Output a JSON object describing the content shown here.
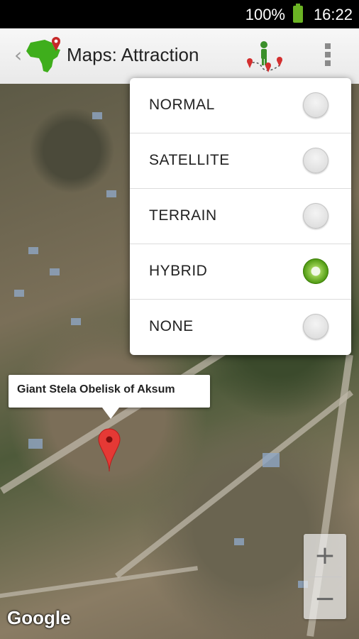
{
  "status_bar": {
    "battery": "100%",
    "time": "16:22"
  },
  "action_bar": {
    "title": "Maps: Attraction"
  },
  "map_type_menu": {
    "items": [
      {
        "label": "NORMAL",
        "selected": false
      },
      {
        "label": "SATELLITE",
        "selected": false
      },
      {
        "label": "TERRAIN",
        "selected": false
      },
      {
        "label": "HYBRID",
        "selected": true
      },
      {
        "label": "NONE",
        "selected": false
      }
    ]
  },
  "marker": {
    "title": "Giant Stela Obelisk of Aksum"
  },
  "zoom": {
    "in": "+",
    "out": "−"
  },
  "attribution": "Google",
  "colors": {
    "accent_green": "#4f9a12",
    "marker_red": "#e53935"
  }
}
